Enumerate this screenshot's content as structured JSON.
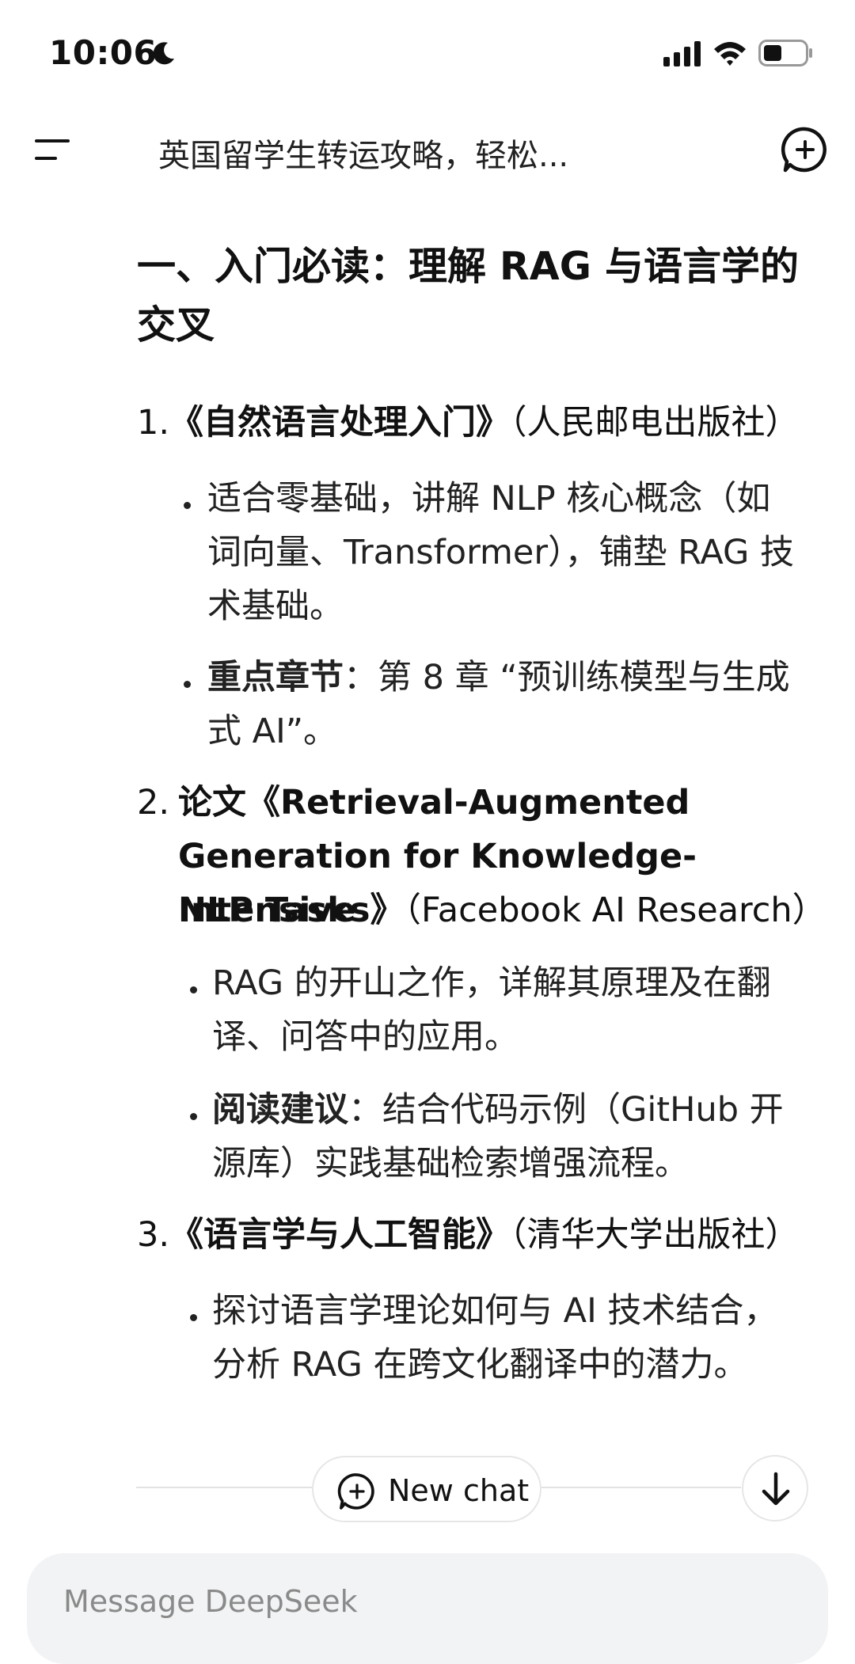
{
  "status_bar": {
    "time": "10:06"
  },
  "header": {
    "title": "英国留学生转运攻略，轻松..."
  },
  "content": {
    "heading": "一、入门必读：理解 RAG 与语言学的交叉",
    "items": [
      {
        "number": "1.",
        "title": "《自然语言处理入门》",
        "publisher": "（人民邮电出版社）",
        "bullets": [
          {
            "text_lines": [
              "适合零基础，讲解 NLP 核心概念（如",
              "词向量、Transformer），铺垫 RAG 技",
              "术基础。"
            ]
          },
          {
            "bold": "重点章节",
            "text_lines": [
              "：第 8 章 “预训练模型与生成",
              "式 AI”。"
            ]
          }
        ]
      },
      {
        "number": "2.",
        "title_lines": [
          "论文《Retrieval-Augmented",
          "Generation for Knowledge-Intensive",
          "NLP Tasks》"
        ],
        "publisher": "（Facebook AI Research）",
        "bullets": [
          {
            "text_lines": [
              "RAG 的开山之作，详解其原理及在翻",
              "译、问答中的应用。"
            ]
          },
          {
            "bold": "阅读建议",
            "text_lines": [
              "：结合代码示例（GitHub 开",
              "源库）实践基础检索增强流程。"
            ]
          }
        ]
      },
      {
        "number": "3.",
        "title": "《语言学与人工智能》",
        "publisher": "（清华大学出版社）",
        "bullets": [
          {
            "text_lines": [
              "探讨语言学理论如何与 AI 技术结合，",
              "分析 RAG 在跨文化翻译中的潜力。"
            ]
          }
        ]
      }
    ]
  },
  "bottom": {
    "new_chat_label": "New chat",
    "composer_placeholder": "Message DeepSeek"
  }
}
